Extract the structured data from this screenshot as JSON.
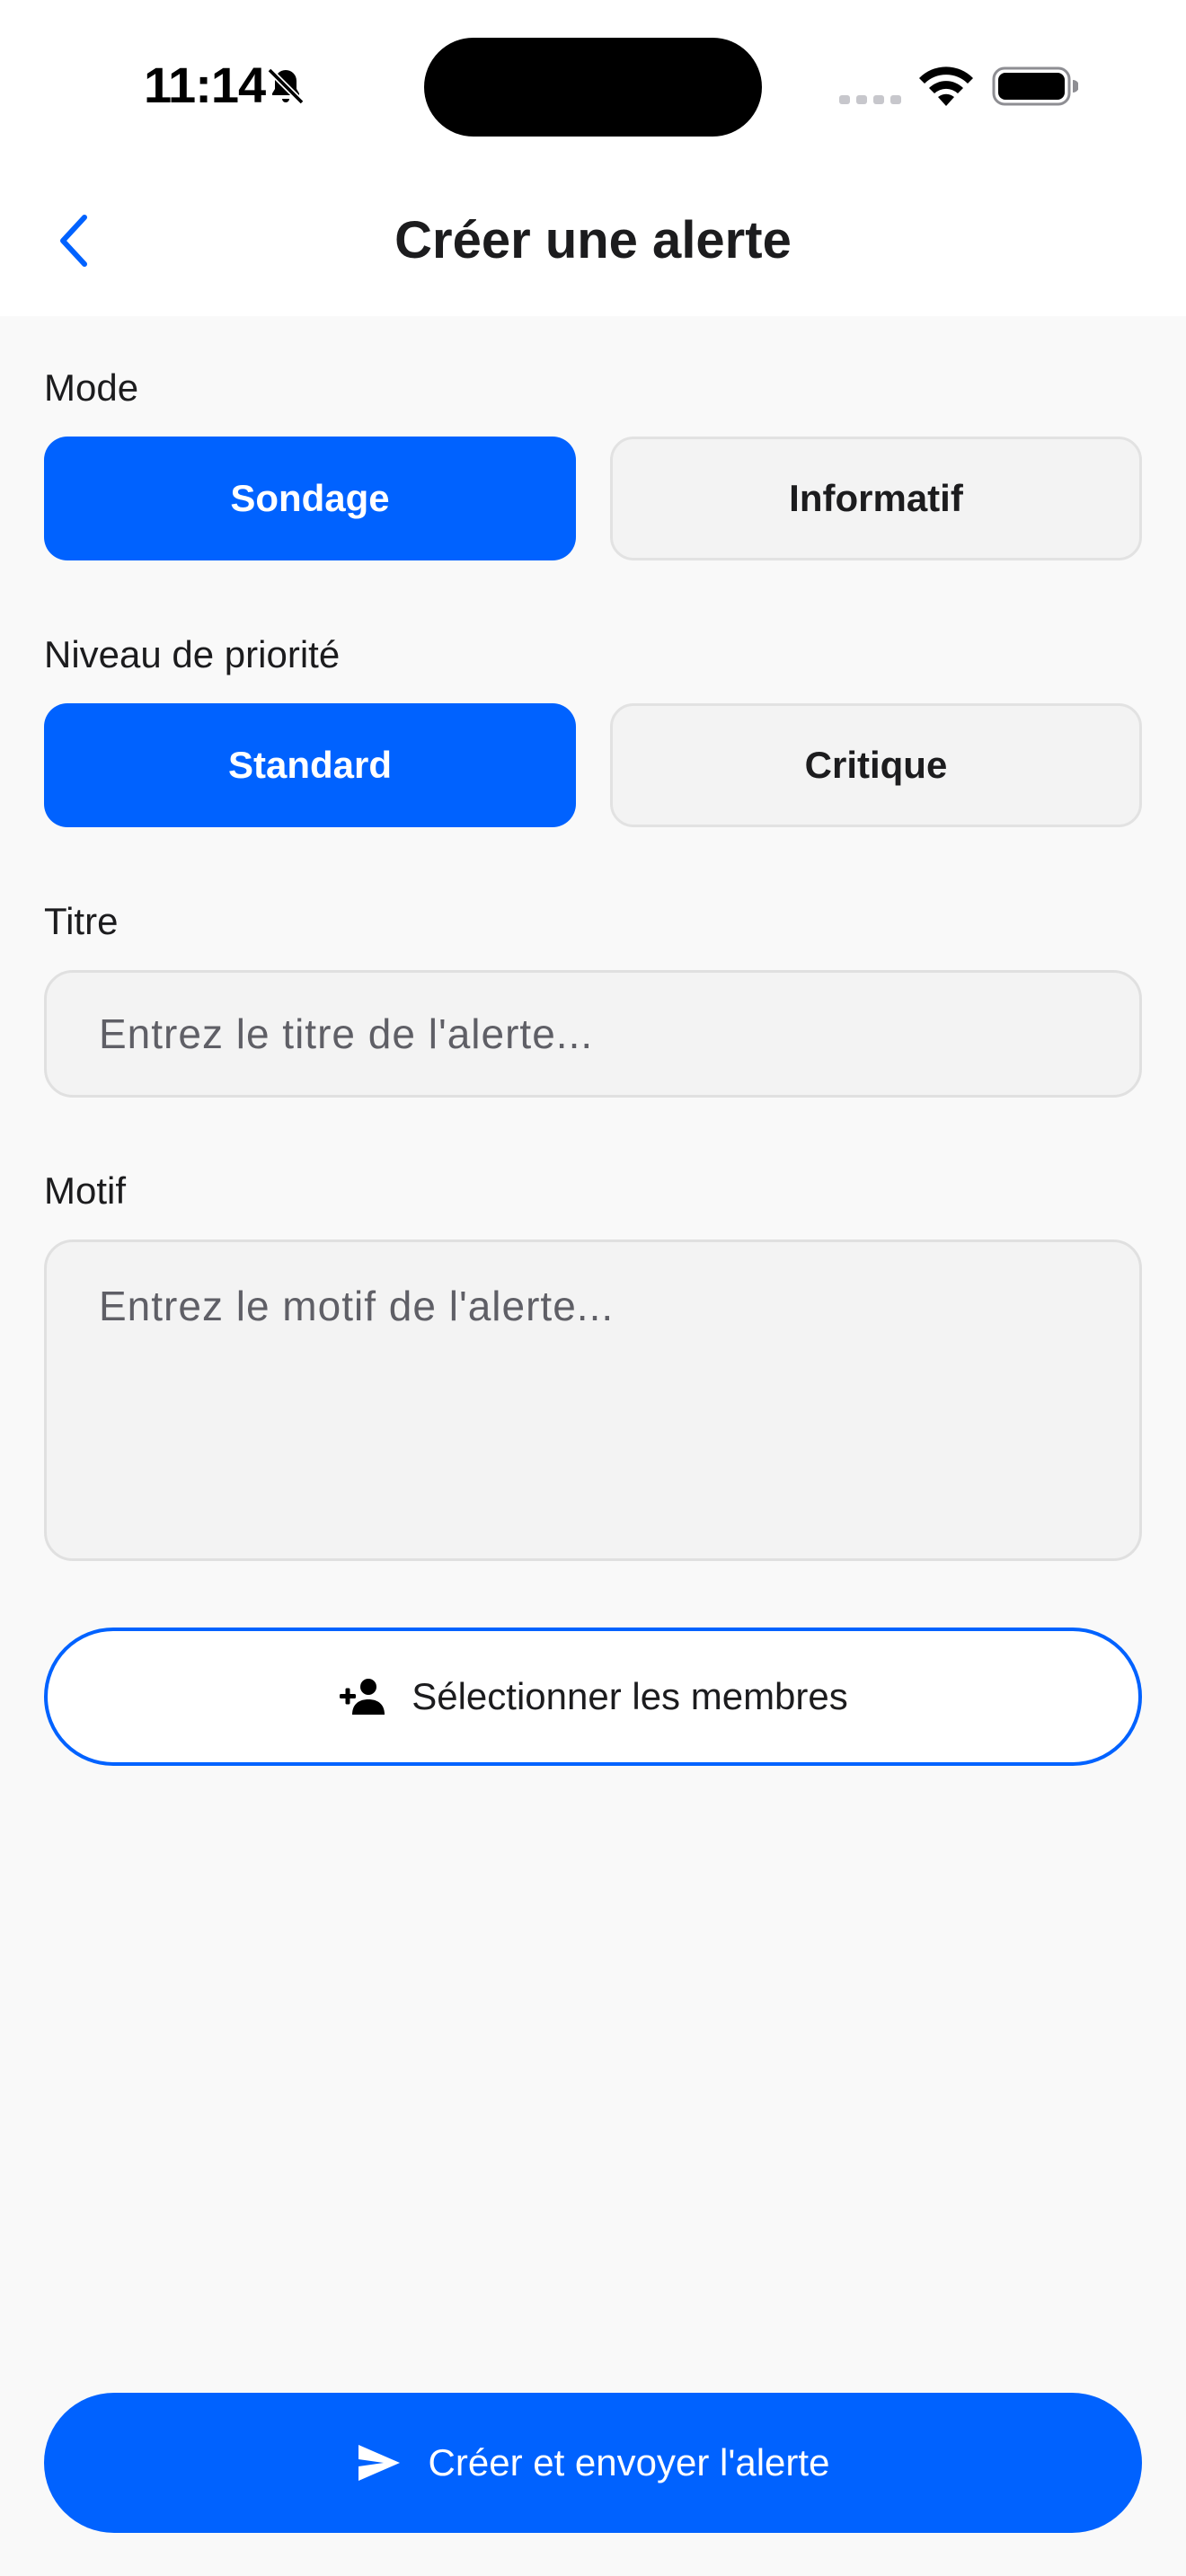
{
  "status_bar": {
    "time": "11:14",
    "icons": [
      "bell-slash-icon",
      "cellular-signal-icon",
      "wifi-icon",
      "battery-icon"
    ]
  },
  "nav": {
    "back_icon": "chevron-left-icon",
    "title": "Créer une alerte"
  },
  "mode": {
    "label": "Mode",
    "options": [
      {
        "label": "Sondage",
        "selected": true
      },
      {
        "label": "Informatif",
        "selected": false
      }
    ]
  },
  "priority": {
    "label": "Niveau de priorité",
    "options": [
      {
        "label": "Standard",
        "selected": true
      },
      {
        "label": "Critique",
        "selected": false
      }
    ]
  },
  "title_field": {
    "label": "Titre",
    "value": "",
    "placeholder": "Entrez le titre de l'alerte..."
  },
  "motif_field": {
    "label": "Motif",
    "value": "",
    "placeholder": "Entrez le motif de l'alerte..."
  },
  "members_button": {
    "icon": "person-add-icon",
    "label": "Sélectionner les membres"
  },
  "send_button": {
    "icon": "send-icon",
    "label": "Créer et envoyer l'alerte"
  },
  "colors": {
    "accent": "#0062ff",
    "background": "#f9f9f9",
    "header": "#ffffff",
    "field_bg": "#f3f3f3",
    "field_border": "#e0e0e0",
    "text": "#1c1c1e",
    "placeholder": "#5f5f66"
  }
}
